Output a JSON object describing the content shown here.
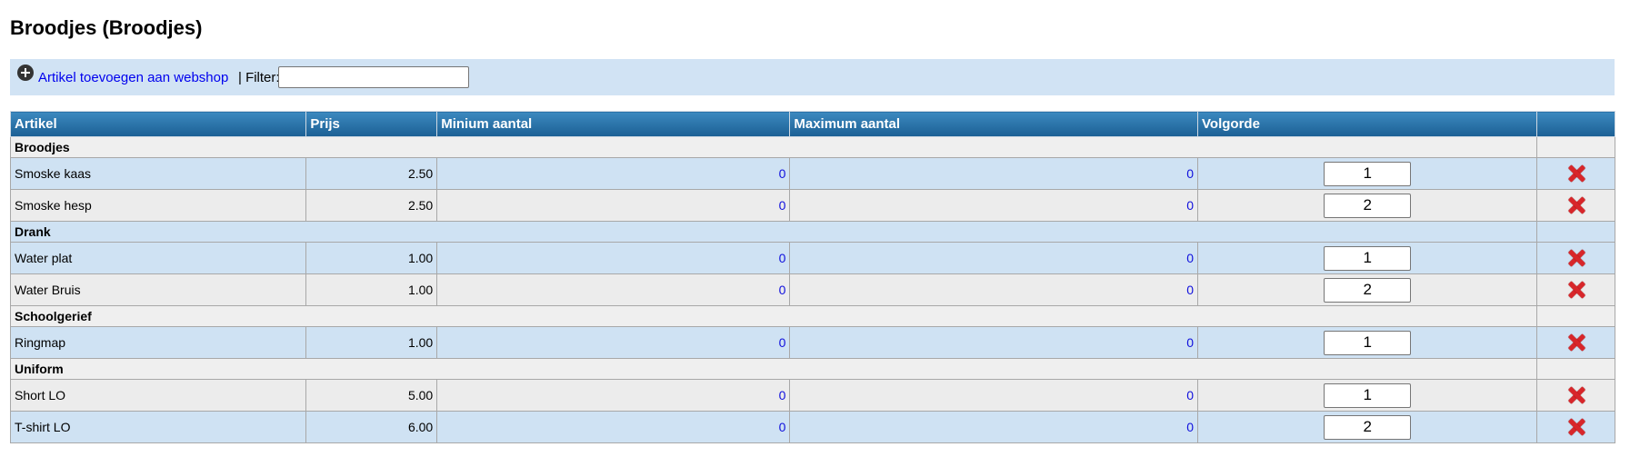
{
  "page": {
    "title": "Broodjes (Broodjes)"
  },
  "toolbar": {
    "add_label": "Artikel toevoegen aan webshop",
    "separator": " | Filter:",
    "filter_value": ""
  },
  "table": {
    "headers": [
      "Artikel",
      "Prijs",
      "Minium aantal",
      "Maximum aantal",
      "Volgorde",
      ""
    ],
    "groups": [
      {
        "name": "Broodjes",
        "rows": [
          {
            "artikel": "Smoske kaas",
            "prijs": "2.50",
            "min": "0",
            "max": "0",
            "volgorde": "1"
          },
          {
            "artikel": "Smoske hesp",
            "prijs": "2.50",
            "min": "0",
            "max": "0",
            "volgorde": "2"
          }
        ]
      },
      {
        "name": "Drank",
        "rows": [
          {
            "artikel": "Water plat",
            "prijs": "1.00",
            "min": "0",
            "max": "0",
            "volgorde": "1"
          },
          {
            "artikel": "Water Bruis",
            "prijs": "1.00",
            "min": "0",
            "max": "0",
            "volgorde": "2"
          }
        ]
      },
      {
        "name": "Schoolgerief",
        "rows": [
          {
            "artikel": "Ringmap",
            "prijs": "1.00",
            "min": "0",
            "max": "0",
            "volgorde": "1"
          }
        ]
      },
      {
        "name": "Uniform",
        "rows": [
          {
            "artikel": "Short LO",
            "prijs": "5.00",
            "min": "0",
            "max": "0",
            "volgorde": "1"
          },
          {
            "artikel": "T-shirt LO",
            "prijs": "6.00",
            "min": "0",
            "max": "0",
            "volgorde": "2"
          }
        ]
      }
    ]
  },
  "colors": {
    "header_top": "#3c89bf",
    "header_bottom": "#1b5f94",
    "row_blue": "#cfe2f3",
    "row_grey": "#ececec",
    "toolbar_bg": "#d1e3f4",
    "delete": "#d8262a",
    "link": "#1010dd"
  },
  "icons": {
    "add": "plus-circle-icon",
    "delete": "red-x-icon"
  }
}
